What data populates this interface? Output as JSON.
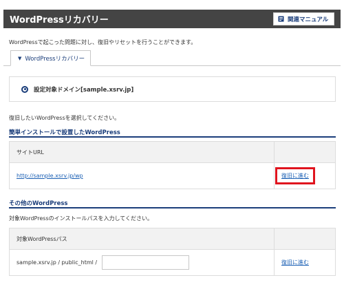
{
  "header": {
    "title": "WordPressリカバリー",
    "manual_button": "関連マニュアル"
  },
  "intro": "WordPressで起こった問題に対し、復旧やリセットを行うことができます。",
  "tab": {
    "label": "WordPressリカバリー"
  },
  "domain": {
    "label": "設定対象ドメイン[sample.xsrv.jp]"
  },
  "select_prompt": "復旧したいWordPressを選択してください。",
  "easy_install": {
    "title": "簡単インストールで設置したWordPress",
    "column_header": "サイトURL",
    "rows": [
      {
        "url": "http://sample.xsrv.jp/wp",
        "action": "復旧に進む"
      }
    ]
  },
  "other": {
    "title": "その他のWordPress",
    "description": "対象WordPressのインストールパスを入力してください。",
    "column_header": "対象WordPressパス",
    "path_prefix": "sample.xsrv.jp / public_html /",
    "path_input_value": "",
    "action": "復旧に進む"
  },
  "colors": {
    "header_bg": "#444444",
    "accent": "#1a3d7a",
    "link": "#1a5fb4",
    "highlight": "#e0141e"
  }
}
